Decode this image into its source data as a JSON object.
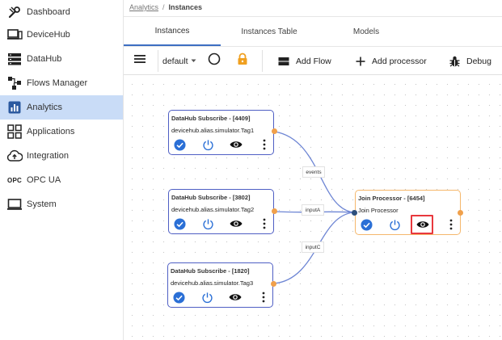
{
  "sidebar": {
    "items": [
      {
        "label": "Dashboard",
        "icon": "tools-icon"
      },
      {
        "label": "DeviceHub",
        "icon": "devicehub-icon"
      },
      {
        "label": "DataHub",
        "icon": "datahub-icon"
      },
      {
        "label": "Flows Manager",
        "icon": "flows-icon"
      },
      {
        "label": "Analytics",
        "icon": "analytics-icon"
      },
      {
        "label": "Applications",
        "icon": "applications-icon"
      },
      {
        "label": "Integration",
        "icon": "integration-icon"
      },
      {
        "label": "OPC UA",
        "icon": "opc-icon",
        "icon_text": "OPC"
      },
      {
        "label": "System",
        "icon": "system-icon"
      }
    ],
    "active_index": 4
  },
  "breadcrumb": {
    "parent": "Analytics",
    "separator": "/",
    "current": "Instances"
  },
  "tabs": [
    {
      "label": "Instances",
      "active": true
    },
    {
      "label": "Instances Table",
      "active": false
    },
    {
      "label": "Models",
      "active": false
    }
  ],
  "toolbar": {
    "flow_select": "default",
    "add_flow": "Add Flow",
    "add_processor": "Add processor",
    "debug": "Debug"
  },
  "nodes": [
    {
      "title": "DataHub Subscribe - [4409]",
      "subtitle": "devicehub.alias.simulator.Tag1"
    },
    {
      "title": "DataHub Subscribe - [3802]",
      "subtitle": "devicehub.alias.simulator.Tag2"
    },
    {
      "title": "DataHub Subscribe - [1820]",
      "subtitle": "devicehub.alias.simulator.Tag3"
    },
    {
      "title": "Join Processor - [6454]",
      "subtitle": "Join Processor"
    }
  ],
  "wire_labels": [
    "events",
    "inputA",
    "inputC"
  ],
  "colors": {
    "accent": "#3d6fc2",
    "active_nav": "#c9dcf7",
    "node_border": "#4f5fc4",
    "selected_node_border": "#f5b76c",
    "port_out": "#f0a04b",
    "highlight": "#e8383d",
    "lock": "#f0a020"
  }
}
